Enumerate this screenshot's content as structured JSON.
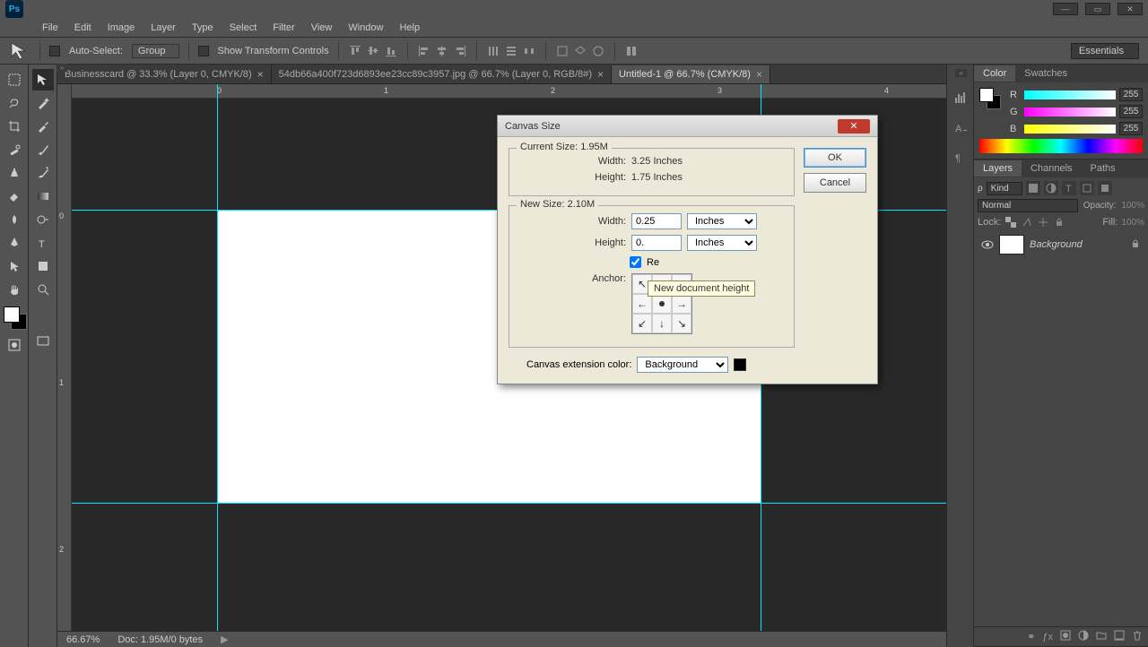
{
  "menubar": [
    "File",
    "Edit",
    "Image",
    "Layer",
    "Type",
    "Select",
    "Filter",
    "View",
    "Window",
    "Help"
  ],
  "optionsbar": {
    "auto_select": "Auto-Select:",
    "group": "Group",
    "show_transform": "Show Transform Controls"
  },
  "workspace": "Essentials",
  "tabs": [
    {
      "label": "Businesscard @ 33.3% (Layer 0, CMYK/8)",
      "active": false
    },
    {
      "label": "54db66a400f723d6893ee23cc89c3957.jpg @ 66.7% (Layer 0, RGB/8#)",
      "active": false
    },
    {
      "label": "Untitled-1 @ 66.7% (CMYK/8)",
      "active": true
    }
  ],
  "ruler_h": [
    "0",
    "1",
    "2",
    "3",
    "4"
  ],
  "ruler_v": [
    "0",
    "1",
    "2"
  ],
  "statusbar": {
    "zoom": "66.67%",
    "doc": "Doc: 1.95M/0 bytes"
  },
  "dialog": {
    "title": "Canvas Size",
    "current_size": "Current Size: 1.95M",
    "current_width_label": "Width:",
    "current_width": "3.25 Inches",
    "current_height_label": "Height:",
    "current_height": "1.75 Inches",
    "new_size": "New Size: 2.10M",
    "width_label": "Width:",
    "width_val": "0.25",
    "width_unit": "Inches",
    "height_label": "Height:",
    "height_val": "0.",
    "height_unit": "Inches",
    "relative": "Re",
    "tooltip": "New document height",
    "anchor_label": "Anchor:",
    "ext_label": "Canvas extension color:",
    "ext_select": "Background",
    "ok": "OK",
    "cancel": "Cancel"
  },
  "color_panel": {
    "tabs": [
      "Color",
      "Swatches"
    ],
    "R": "255",
    "G": "255",
    "B": "255"
  },
  "layers_panel": {
    "tabs": [
      "Layers",
      "Channels",
      "Paths"
    ],
    "kind": "Kind",
    "blend": "Normal",
    "opacity_label": "Opacity:",
    "opacity": "100%",
    "lock_label": "Lock:",
    "fill_label": "Fill:",
    "fill": "100%",
    "layers": [
      {
        "name": "Background"
      }
    ]
  }
}
